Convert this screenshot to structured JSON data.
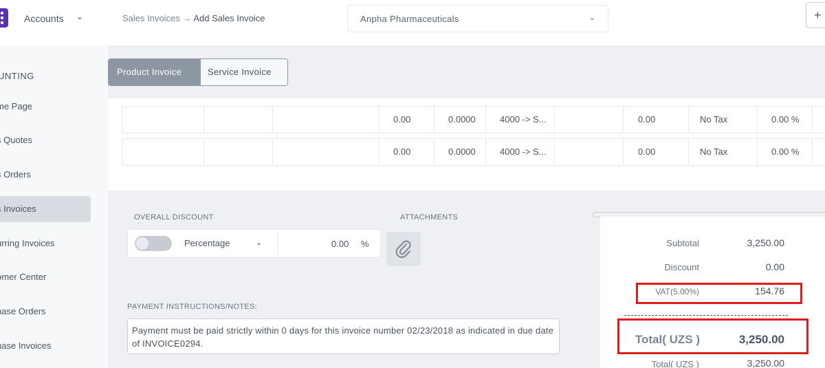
{
  "sidebar": {
    "title": "Accounts",
    "section": "UNTING",
    "items": [
      {
        "label": "me Page"
      },
      {
        "label": "s Quotes"
      },
      {
        "label": "s Orders"
      },
      {
        "label": "s Invoices",
        "active": true
      },
      {
        "label": "urring Invoices"
      },
      {
        "label": "omer Center"
      },
      {
        "label": "hase Orders"
      },
      {
        "label": "hase Invoices"
      }
    ]
  },
  "header": {
    "breadcrumb_parent": "Sales Invoices",
    "breadcrumb_arrow": "→",
    "breadcrumb_current": "Add Sales Invoice",
    "company": "Anpha Pharmaceuticals",
    "add_label": "+"
  },
  "tabs": [
    {
      "label": "Product Invoice",
      "active": true
    },
    {
      "label": "Service Invoice",
      "active": false
    }
  ],
  "line_rows": [
    {
      "qty": "0.00",
      "rate": "0.0000",
      "account": "4000 -> S...",
      "amount": "0.00",
      "tax": "No Tax",
      "tax_pct": "0.00 %"
    },
    {
      "qty": "0.00",
      "rate": "0.0000",
      "account": "4000 -> S...",
      "amount": "0.00",
      "tax": "No Tax",
      "tax_pct": "0.00 %"
    }
  ],
  "discount": {
    "label": "OVERALL DISCOUNT",
    "type": "Percentage",
    "value": "0.00",
    "unit": "%"
  },
  "attachments": {
    "label": "ATTACHMENTS"
  },
  "notes": {
    "label": "PAYMENT INSTRUCTIONS/NOTES:",
    "text": "Payment must be paid strictly within 0 days for this invoice number 02/23/2018 as indicated in due date of INVOICE0294."
  },
  "totals": {
    "subtotal_label": "Subtotal",
    "subtotal_value": "3,250.00",
    "discount_label": "Discount",
    "discount_value": "0.00",
    "vat_label": "VAT(5.00%)",
    "vat_value": "154.76",
    "total_label": "Total( UZS )",
    "total_value": "3,250.00",
    "total2_label": "Total( UZS )",
    "total2_value": "3,250.00"
  },
  "colors": {
    "highlight": "#e11b1b",
    "tab_active": "#8d97a3",
    "logo": "#5a2fb0"
  }
}
